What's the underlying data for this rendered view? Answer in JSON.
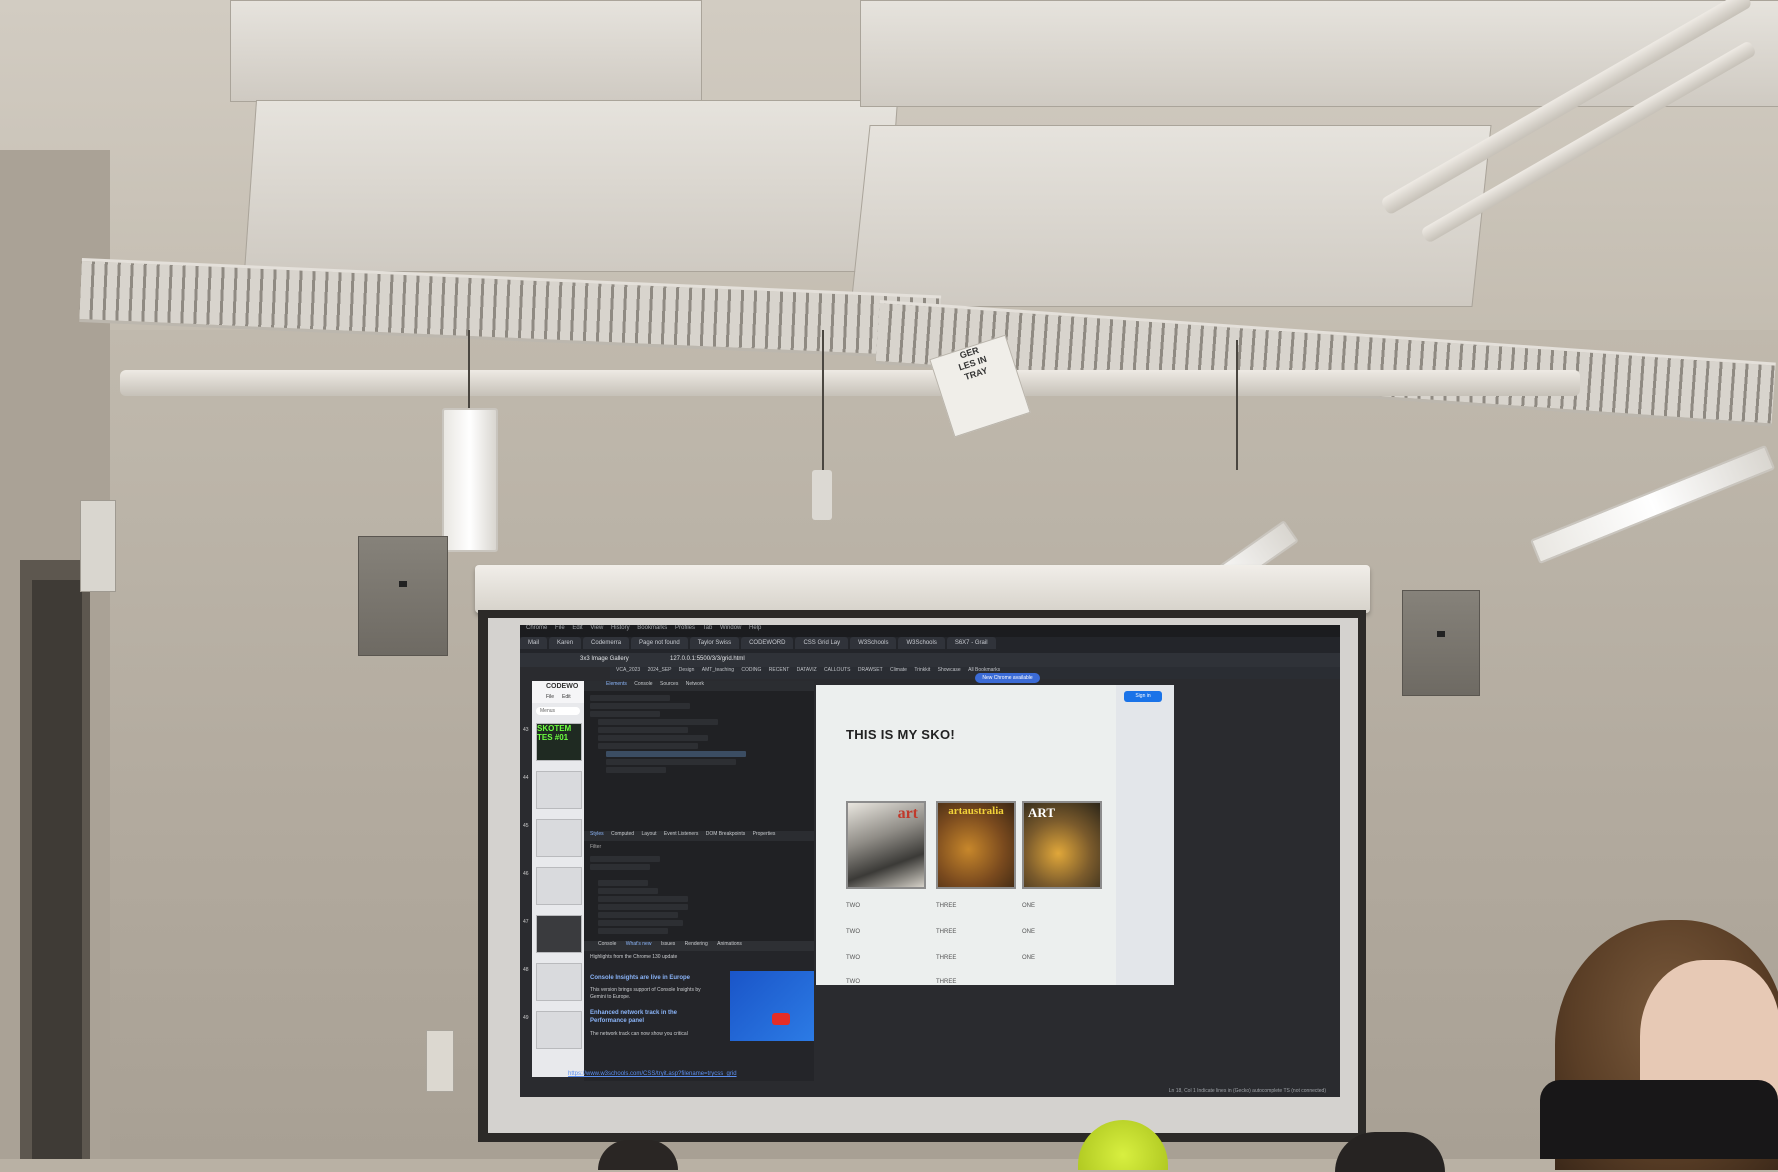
{
  "scene": {
    "ceiling_sign": "GER\nLES IN\nTRAY"
  },
  "projection": {
    "browser": {
      "menu_items": [
        "Chrome",
        "File",
        "Edit",
        "View",
        "History",
        "Bookmarks",
        "Profiles",
        "Tab",
        "Window",
        "Help"
      ],
      "tabs": [
        "Mail",
        "Karen",
        "Codemerra",
        "Page not found",
        "Taylor Swiss",
        "CODEWORD",
        "CSS Grid Lay",
        "W3Schools",
        "W3Schools",
        "S6X7 - Grail"
      ],
      "address": "127.0.0.1:5500/3/3/grid.html",
      "window_title": "3x3 Image Gallery",
      "bookmarks": [
        "VCA_2023",
        "2024_SEP",
        "Design",
        "AMT_teaching",
        "CODING",
        "RECENT",
        "DATAVIZ",
        "CALLOUTS",
        "DRAWSET",
        "Climate",
        "Trinkkit",
        "Showcase",
        "All Bookmarks"
      ],
      "chrome_badge": "New Chrome available",
      "sign_in": "Sign in"
    },
    "editor": {
      "title": "CODEWO",
      "menu": [
        "File",
        "Edit"
      ],
      "search_placeholder": "Menus",
      "slide_numbers": [
        "43",
        "44",
        "45",
        "46",
        "47",
        "48",
        "49"
      ],
      "green_thumb_text": "SKOTEM\nTES #01"
    },
    "devtools": {
      "tabs": [
        "Elements",
        "Console",
        "Sources",
        "Network"
      ],
      "style_tabs": [
        "Styles",
        "Computed",
        "Layout",
        "Event Listeners",
        "DOM Breakpoints",
        "Properties"
      ],
      "filter_placeholder": "Filter",
      "drawer_tabs": [
        "Console",
        "What's new",
        "Issues",
        "Rendering",
        "Animations"
      ],
      "drawer_intro": "Highlights from the Chrome 130 update",
      "drawer_heading_1": "Console Insights are live in Europe",
      "drawer_text_1": "This version brings support of Console Insights by Gemini to Europe.",
      "drawer_heading_2": "Enhanced network track in the Performance panel",
      "drawer_text_2": "The network track can now show you critical"
    },
    "page": {
      "title": "THIS IS MY SKO!",
      "covers": [
        "art",
        "artaustralia",
        "ART"
      ],
      "grid": [
        [
          "TWO",
          "THREE",
          "ONE"
        ],
        [
          "TWO",
          "THREE",
          "ONE"
        ],
        [
          "TWO",
          "THREE",
          "ONE"
        ],
        [
          "TWO",
          "THREE",
          ""
        ]
      ]
    },
    "link": "https://www.w3schools.com/CSS/tryit.asp?filename=trycss_grid",
    "statusbar": "Ln 18, Col 1   Indicate lines in (Gecko) autocomplete TS (not connected)"
  }
}
